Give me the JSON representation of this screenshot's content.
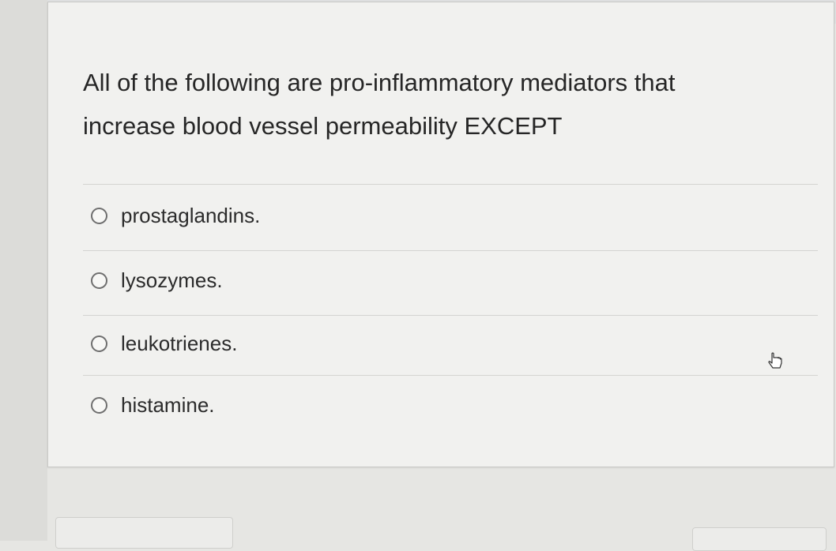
{
  "question": {
    "line1": "All of the following are pro-inflammatory mediators that",
    "line2": "increase blood vessel permeability EXCEPT"
  },
  "options": [
    {
      "label": "prostaglandins.",
      "selected": false
    },
    {
      "label": "lysozymes.",
      "selected": false
    },
    {
      "label": "leukotrienes.",
      "selected": false
    },
    {
      "label": "histamine.",
      "selected": false
    }
  ],
  "icons": {
    "cursor": "hand-pointer-icon",
    "radio": "radio-unselected-icon"
  },
  "colors": {
    "card_background": "#f1f1ef",
    "page_background": "#e6e6e3",
    "text": "#262626",
    "radio_border": "#6f6f6f"
  }
}
